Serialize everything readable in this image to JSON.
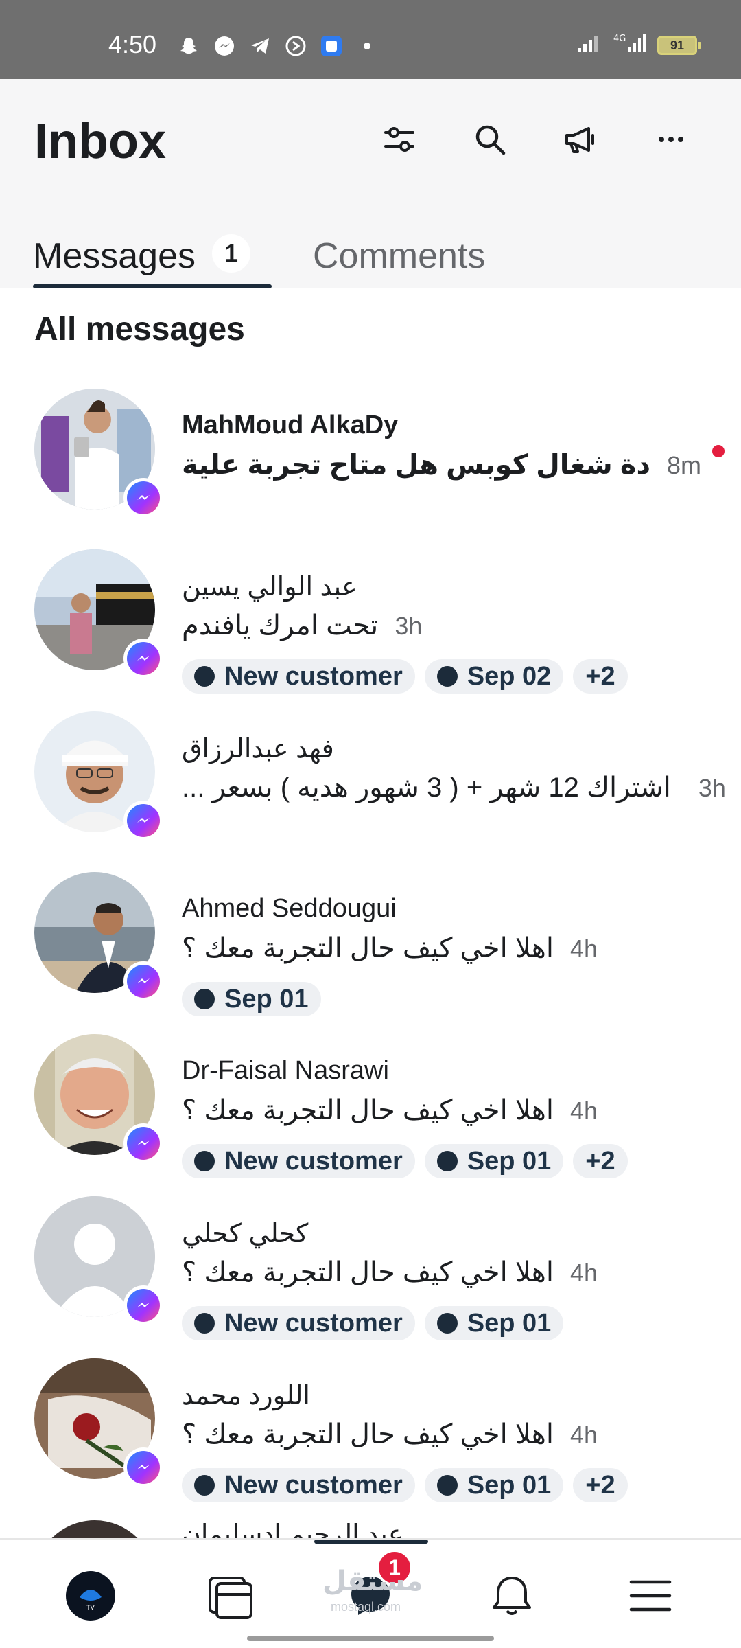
{
  "status_bar": {
    "time": "4:50",
    "battery": "91",
    "icons": [
      "snapchat-icon",
      "messenger-icon",
      "telegram-icon",
      "shazam-icon",
      "app-icon",
      "dot-icon"
    ]
  },
  "header": {
    "title": "Inbox",
    "icons": [
      "filter-icon",
      "search-icon",
      "megaphone-icon",
      "more-icon"
    ]
  },
  "tabs": [
    {
      "label": "Messages",
      "badge": "1",
      "active": true
    },
    {
      "label": "Comments",
      "active": false
    }
  ],
  "section_title": "All messages",
  "conversations": [
    {
      "name": "MahMoud AlkaDy",
      "preview": "دة شغال كوبس هل متاح تجربة علية",
      "time": "8m",
      "unread": true,
      "tags": []
    },
    {
      "name": "عبد الوالي يسين",
      "preview": "تحت امرك يافندم",
      "time": "3h",
      "unread": false,
      "tags": [
        "New customer",
        "Sep 02"
      ],
      "more": "+2"
    },
    {
      "name": "فهد عبدالرزاق",
      "preview": "اشتراك 12 شهر + ( 3 شهور هديه ) بسعر ...",
      "time": "3h",
      "unread": false,
      "tags": []
    },
    {
      "name": "Ahmed Seddougui",
      "preview": "اهلا اخي كيف حال التجربة معك ؟",
      "time": "4h",
      "unread": false,
      "tags": [
        "Sep 01"
      ]
    },
    {
      "name": "Dr-Faisal Nasrawi",
      "preview": "اهلا اخي كيف حال التجربة معك ؟",
      "time": "4h",
      "unread": false,
      "tags": [
        "New customer",
        "Sep 01"
      ],
      "more": "+2"
    },
    {
      "name": "كحلي كحلي",
      "preview": "اهلا اخي كيف حال التجربة معك ؟",
      "time": "4h",
      "unread": false,
      "tags": [
        "New customer",
        "Sep 01"
      ]
    },
    {
      "name": "اللورد محمد",
      "preview": "اهلا اخي كيف حال التجربة معك ؟",
      "time": "4h",
      "unread": false,
      "tags": [
        "New customer",
        "Sep 01"
      ],
      "more": "+2"
    },
    {
      "name": "عبد الرحيم ادسليمان",
      "preview": "",
      "time": "",
      "unread": false,
      "tags": []
    }
  ],
  "bottom_nav": {
    "items": [
      "profile-avatar",
      "pages-icon",
      "inbox-icon",
      "notifications-bell-icon",
      "menu-icon"
    ],
    "inbox_badge": "1"
  },
  "watermark": {
    "text": "مستقل",
    "sub": "mostaql.com"
  },
  "colors": {
    "accent": "#1c2b3a",
    "unread": "#e41e3f",
    "tag_bg": "#eef0f3"
  }
}
